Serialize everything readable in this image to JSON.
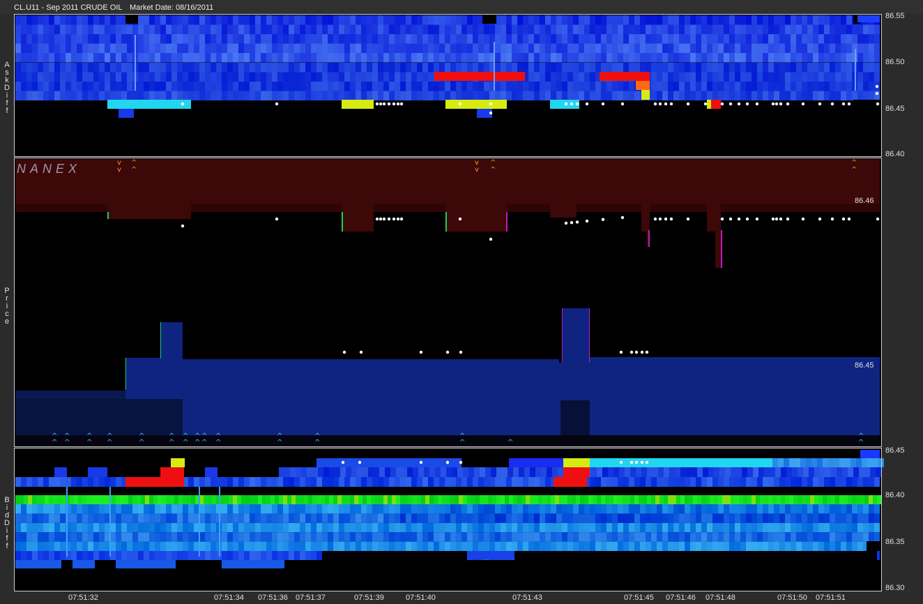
{
  "header": {
    "symbol": "CL.U11 - Sep 2011 CRUDE OIL",
    "market_date": "Market Date: 08/16/2011"
  },
  "panels": {
    "ask_label": [
      "A",
      "s",
      "k",
      "D",
      "i",
      "f",
      "f"
    ],
    "price_label": [
      "P",
      "r",
      "i",
      "c",
      "e"
    ],
    "bid_label": [
      "B",
      "i",
      "d",
      "D",
      "i",
      "f",
      "f"
    ],
    "watermark": "NANEX"
  },
  "colors": {
    "background": "#000000",
    "frame": "#2b2b2b",
    "ask_band": "#1e3fe0",
    "bid_band": "#1e5ae8",
    "green_band": "#22e622",
    "red": "#ee1010",
    "yellow": "#d6ec10",
    "cyan": "#22d6f0",
    "orange": "#ff6a10",
    "ask_price_fill": "#3a0a0a",
    "bid_price_fill": "#0a1870"
  },
  "chart_data": [
    {
      "type": "heatmap",
      "title": "",
      "ylabel": "AskDiff",
      "y_ticks": [
        "86.55",
        "86.50",
        "86.45",
        "86.40"
      ],
      "ylim": [
        86.4,
        86.55
      ],
      "x_ticks": [
        "07:51:32",
        "07:51:34",
        "07:51:36",
        "07:51:37",
        "07:51:39",
        "07:51:40",
        "07:51:43",
        "07:51:45",
        "07:51:46",
        "07:51:48",
        "07:51:50",
        "07:51:51"
      ]
    },
    {
      "type": "area",
      "title": "",
      "ylabel": "Price",
      "y_ticks": [
        "86.46",
        "86.45"
      ],
      "series": [
        {
          "name": "ask",
          "values": [
            86.461,
            86.461,
            86.461,
            86.46,
            86.46,
            86.461,
            86.461,
            86.46,
            86.46,
            86.46,
            86.46,
            86.461
          ]
        },
        {
          "name": "bid",
          "values": [
            86.449,
            86.45,
            86.451,
            86.451,
            86.451,
            86.451,
            86.452,
            86.451,
            86.451,
            86.451,
            86.451,
            86.451
          ]
        }
      ]
    },
    {
      "type": "heatmap",
      "title": "",
      "ylabel": "BidDiff",
      "y_ticks": [
        "86.45",
        "86.40",
        "86.35",
        "86.30"
      ],
      "ylim": [
        86.3,
        86.45
      ]
    }
  ]
}
